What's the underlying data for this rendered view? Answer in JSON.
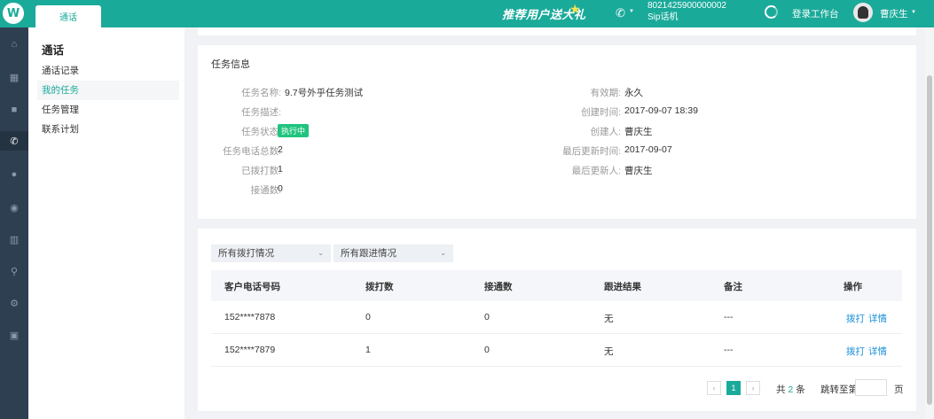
{
  "topbar": {
    "logo_glyph": "W",
    "tab_label": "通话",
    "promo_text": "推荐用户送大礼",
    "sip_number": "8021425900000002",
    "sip_label": "Sip话机",
    "login_workbench": "登录工作台",
    "user_name": "曹庆生",
    "accent_color": "#1aaa9a"
  },
  "rail": {
    "icons": [
      "home-icon",
      "grid-icon",
      "document-icon",
      "phone-icon",
      "user-icon",
      "users-icon",
      "bar-chart-icon",
      "search-icon",
      "gear-icon",
      "shield-icon"
    ],
    "active": "phone-icon"
  },
  "subnav": {
    "title": "通话",
    "items": [
      {
        "label": "通话记录"
      },
      {
        "label": "我的任务"
      },
      {
        "label": "任务管理"
      },
      {
        "label": "联系计划"
      }
    ],
    "active_index": 1
  },
  "task_info": {
    "title": "任务信息",
    "left": [
      {
        "label": "任务名称:",
        "value": "9.7号外乎任务测试"
      },
      {
        "label": "任务描述:",
        "value": ""
      },
      {
        "label": "任务状态:",
        "value": "执行中"
      },
      {
        "label": "任务电话总数:",
        "value": "2"
      },
      {
        "label": "已拨打数:",
        "value": "1"
      },
      {
        "label": "接通数:",
        "value": "0"
      }
    ],
    "right": [
      {
        "label": "有效期:",
        "value": "永久"
      },
      {
        "label": "创建时间:",
        "value": "2017-09-07 18:39"
      },
      {
        "label": "创建人:",
        "value": "曹庆生"
      },
      {
        "label": "最后更新时间:",
        "value": "2017-09-07"
      },
      {
        "label": "最后更新人:",
        "value": "曹庆生"
      }
    ],
    "status_color": "#21c47f"
  },
  "filters": {
    "dial_status": "所有拨打情况",
    "follow_status": "所有跟进情况"
  },
  "table": {
    "headers": [
      "客户电话号码",
      "拨打数",
      "接通数",
      "跟进结果",
      "备注",
      "操作"
    ],
    "rows": [
      {
        "phone": "152****7878",
        "dials": "0",
        "connected": "0",
        "result": "无",
        "note": "---",
        "action_call": "拨打",
        "action_detail": "详情"
      },
      {
        "phone": "152****7879",
        "dials": "1",
        "connected": "0",
        "result": "无",
        "note": "---",
        "action_call": "拨打",
        "action_detail": "详情"
      }
    ]
  },
  "pagination": {
    "prev": "‹",
    "current": "1",
    "next": "›",
    "total_prefix": "共",
    "total_count": "2",
    "total_suffix": "条",
    "jump_label": "跳转至第",
    "page_suffix": "页"
  }
}
